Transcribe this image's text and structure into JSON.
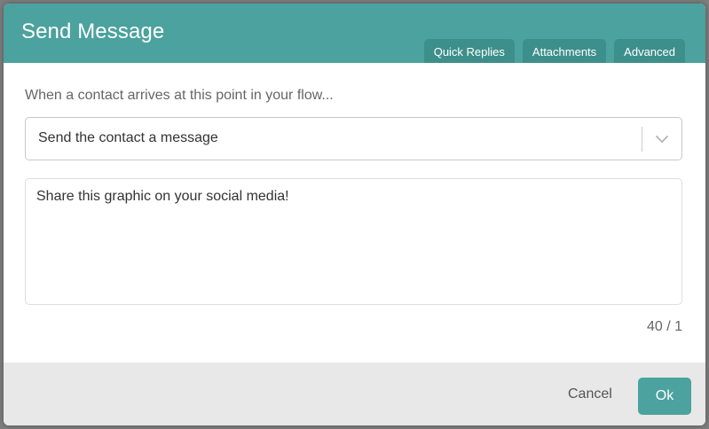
{
  "dialog": {
    "title": "Send Message",
    "tabs": [
      {
        "label": "Quick Replies"
      },
      {
        "label": "Attachments"
      },
      {
        "label": "Advanced"
      }
    ]
  },
  "form": {
    "prompt": "When a contact arrives at this point in your flow...",
    "action_select": {
      "value": "Send the contact a message",
      "icon": "chevron-down-icon"
    },
    "message": {
      "value": "Share this graphic on your social media!"
    },
    "counter": "40 / 1"
  },
  "footer": {
    "cancel_label": "Cancel",
    "ok_label": "Ok"
  },
  "colors": {
    "header": "#4ba29e",
    "tab": "#3d8f8b",
    "footer": "#e8e8e8",
    "primary_button": "#4ba29e"
  }
}
